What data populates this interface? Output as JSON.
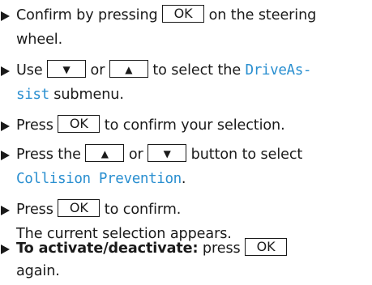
{
  "steps": [
    {
      "a": "Confirm by pressing ",
      "key": "OK",
      "b": " on the steering",
      "c": "wheel."
    },
    {
      "a": "Use ",
      "key1": "▼",
      "or": " or ",
      "key2": "▲",
      "b": " to select the ",
      "disp1": "DriveAs-",
      "disp2": "sist",
      "c": " submenu."
    },
    {
      "a": "Press ",
      "key": "OK",
      "b": " to confirm your selection."
    },
    {
      "a": "Press the ",
      "key1": "▲",
      "or": " or ",
      "key2": "▼",
      "b": " button to select",
      "disp": "Collision Prevention",
      "end": "."
    },
    {
      "a": "Press ",
      "key": "OK",
      "b": " to confirm.",
      "c": "The current selection appears."
    },
    {
      "bold": "To activate/deactivate:",
      "a": " press ",
      "key": "OK",
      "c": "again."
    }
  ],
  "colors": {
    "display_text": "#2a8fd0",
    "body_text": "#1a1a1a"
  },
  "icons": {
    "bullet": "triangle-bullet-icon"
  }
}
